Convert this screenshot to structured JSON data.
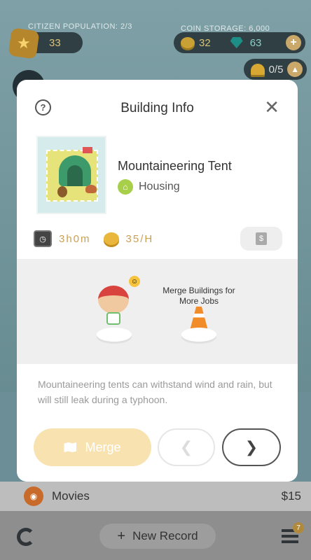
{
  "hud": {
    "population_label": "CITIZEN POPULATION: 2/3",
    "level": "33",
    "storage_label": "COIN STORAGE: 6,000",
    "coins": "32",
    "gems": "63",
    "hardhat_count": "0/5"
  },
  "modal": {
    "title": "Building Info",
    "building_name": "Mountaineering Tent",
    "building_type": "Housing",
    "build_time": "3h0m",
    "income": "35/H",
    "merge_hint": "Merge Buildings for More Jobs",
    "description": "Mountaineering tents can withstand wind and rain, but will still leak during a typhoon.",
    "merge_label": "Merge",
    "sell_symbol": "$"
  },
  "list_row": {
    "label": "Movies",
    "amount": "$15"
  },
  "bottom_bar": {
    "new_record_label": "New Record",
    "menu_badge": "7"
  }
}
